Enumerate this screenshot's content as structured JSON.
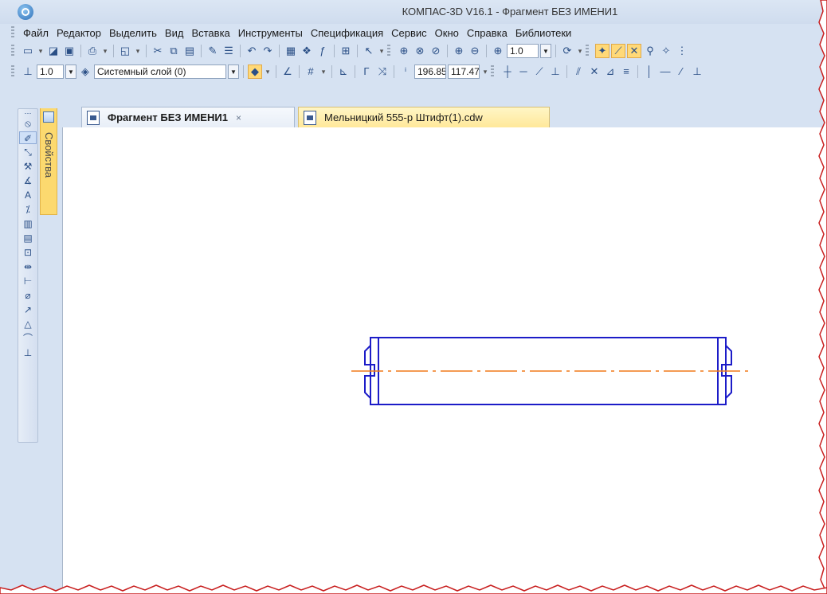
{
  "window": {
    "title": "КОМПАС-3D V16.1 - Фрагмент БЕЗ ИМЕНИ1"
  },
  "menu": {
    "items": [
      {
        "label": "Файл"
      },
      {
        "label": "Редактор"
      },
      {
        "label": "Выделить"
      },
      {
        "label": "Вид"
      },
      {
        "label": "Вставка"
      },
      {
        "label": "Инструменты"
      },
      {
        "label": "Спецификация"
      },
      {
        "label": "Сервис"
      },
      {
        "label": "Окно"
      },
      {
        "label": "Справка"
      },
      {
        "label": "Библиотеки"
      }
    ]
  },
  "toolbar1": {
    "zoom_value": "1.0"
  },
  "toolbar2": {
    "line_scale": "1.0",
    "layer": "Системный слой (0)",
    "coord_x": "196.85",
    "coord_y": "117.47"
  },
  "tabs": [
    {
      "label": "Фрагмент БЕЗ ИМЕНИ1",
      "close": "×"
    },
    {
      "label": "Мельницкий 555-р Штифт(1).cdw"
    }
  ],
  "side_panel": {
    "label": "Свойства"
  },
  "colors": {
    "outline": "#1c1cc8",
    "centerline": "#f07a1a",
    "torn_edge": "#c81e1e",
    "tab_active": "#ffe89a"
  }
}
